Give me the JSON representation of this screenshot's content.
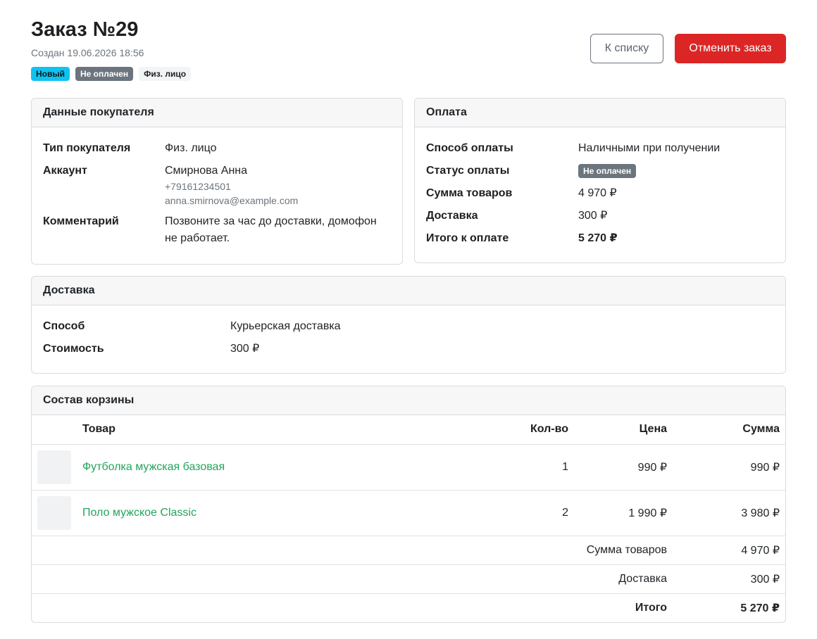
{
  "order": {
    "title": "Заказ №29",
    "created": "Создан 19.06.2026 18:56",
    "badges": {
      "status": "Новый",
      "payment": "Не оплачен",
      "type": "Физ. лицо"
    },
    "buttons": {
      "back": "К списку",
      "cancel": "Отменить заказ"
    }
  },
  "buyer": {
    "header": "Данные покупателя",
    "type_label": "Тип покупателя",
    "type_value": "Физ. лицо",
    "account_label": "Аккаунт",
    "account_name": "Смирнова Анна",
    "account_phone": "+79161234501",
    "account_email": "anna.smirnova@example.com",
    "comment_label": "Комментарий",
    "comment_value": "Позвоните за час до доставки, домофон не работает."
  },
  "payment": {
    "header": "Оплата",
    "method_label": "Способ оплаты",
    "method_value": "Наличными при получении",
    "status_label": "Статус оплаты",
    "status_value": "Не оплачен",
    "goods_label": "Сумма товаров",
    "goods_value": "4 970 ₽",
    "delivery_label": "Доставка",
    "delivery_value": "300 ₽",
    "total_label": "Итого к оплате",
    "total_value": "5 270 ₽"
  },
  "delivery": {
    "header": "Доставка",
    "method_label": "Способ",
    "method_value": "Курьерская доставка",
    "cost_label": "Стоимость",
    "cost_value": "300 ₽"
  },
  "cart": {
    "header": "Состав корзины",
    "columns": {
      "product": "Товар",
      "qty": "Кол-во",
      "price": "Цена",
      "sum": "Сумма"
    },
    "items": [
      {
        "name": "Футболка мужская базовая",
        "qty": "1",
        "price": "990 ₽",
        "sum": "990 ₽"
      },
      {
        "name": "Поло мужское Classic",
        "qty": "2",
        "price": "1 990 ₽",
        "sum": "3 980 ₽"
      }
    ],
    "totals": {
      "goods_label": "Сумма товаров",
      "goods_value": "4 970 ₽",
      "delivery_label": "Доставка",
      "delivery_value": "300 ₽",
      "total_label": "Итого",
      "total_value": "5 270 ₽"
    }
  },
  "colors": {
    "badge_new": "#10c3ee",
    "badge_unpaid": "#6c757d",
    "danger": "#dc2626",
    "product_link": "#22a55a"
  }
}
